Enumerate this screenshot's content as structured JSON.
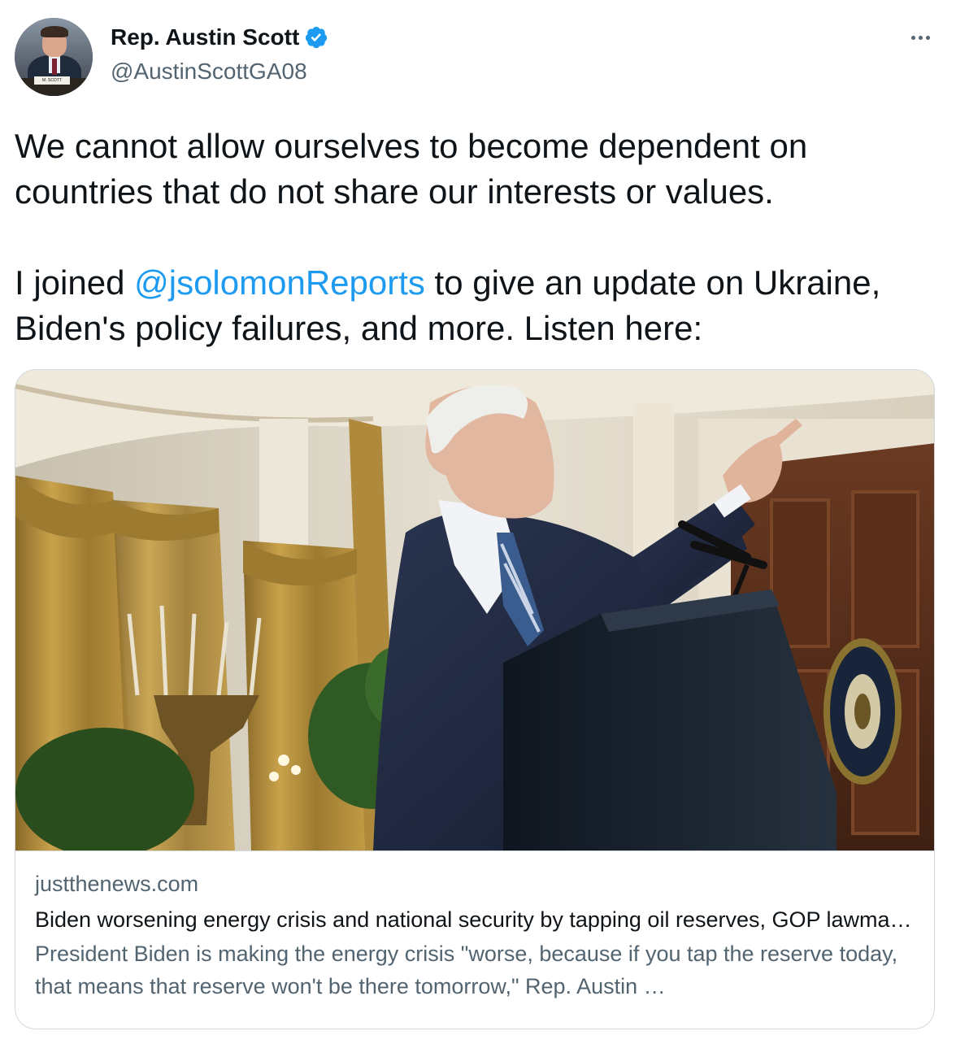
{
  "author": {
    "display_name": "Rep. Austin Scott",
    "handle": "@AustinScottGA08",
    "verified": true,
    "avatar_plate_text": "M. SCOTT"
  },
  "menu": {
    "icon": "more-horizontal-icon"
  },
  "tweet": {
    "paragraph_1": "We cannot allow ourselves to become dependent on countries that do not share our interests or values.",
    "paragraph_2_prefix": "I joined ",
    "mention": "@jsolomonReports",
    "paragraph_2_suffix": " to give an update on Ukraine, Biden's policy failures, and more. Listen here:"
  },
  "link_card": {
    "domain": "justthenews.com",
    "title": "Biden worsening energy crisis and national security by tapping oil reserves, GOP lawmaker says",
    "description": "President Biden is making the energy crisis \"worse, because if you tap the reserve today, that means that reserve won't be there tomorrow,\" Rep. Austin …"
  },
  "colors": {
    "link": "#1d9bf0",
    "text_primary": "#0f1419",
    "text_secondary": "#536471",
    "border": "#cfd9de",
    "verified_badge": "#1d9bf0"
  }
}
